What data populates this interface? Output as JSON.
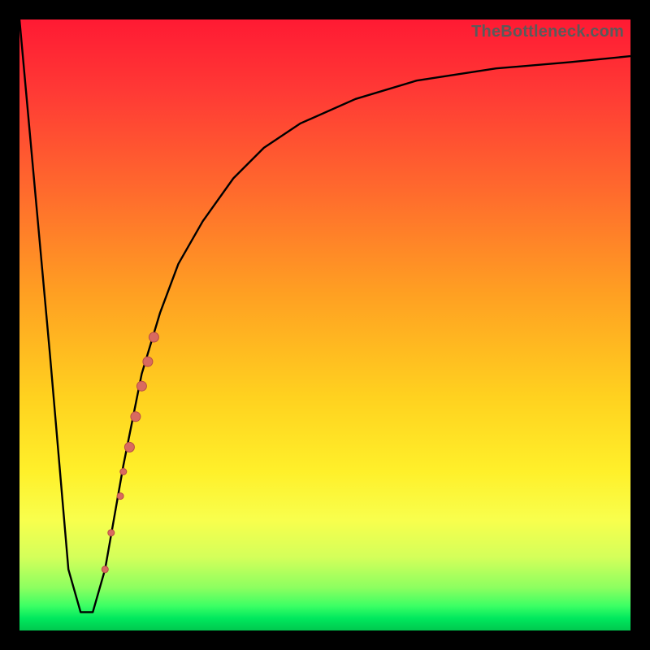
{
  "attribution": "TheBottleneck.com",
  "colors": {
    "background_frame": "#000000",
    "curve": "#000000",
    "marker_fill": "#d96a5f",
    "marker_stroke": "#b84d44"
  },
  "chart_data": {
    "type": "line",
    "title": "",
    "xlabel": "",
    "ylabel": "",
    "xlim": [
      0,
      100
    ],
    "ylim": [
      0,
      100
    ],
    "grid": false,
    "series": [
      {
        "name": "bottleneck-curve",
        "x": [
          0,
          5,
          8,
          10,
          12,
          14,
          17,
          20,
          23,
          26,
          30,
          35,
          40,
          46,
          55,
          65,
          78,
          90,
          100
        ],
        "values": [
          100,
          45,
          10,
          3,
          3,
          10,
          27,
          42,
          52,
          60,
          67,
          74,
          79,
          83,
          87,
          90,
          92,
          93,
          94
        ]
      }
    ],
    "markers": [
      {
        "x": 14.0,
        "y": 10.0,
        "r": 4
      },
      {
        "x": 15.0,
        "y": 16.0,
        "r": 4
      },
      {
        "x": 16.5,
        "y": 22.0,
        "r": 4
      },
      {
        "x": 17.0,
        "y": 26.0,
        "r": 4
      },
      {
        "x": 18.0,
        "y": 30.0,
        "r": 6
      },
      {
        "x": 19.0,
        "y": 35.0,
        "r": 6
      },
      {
        "x": 20.0,
        "y": 40.0,
        "r": 6
      },
      {
        "x": 21.0,
        "y": 44.0,
        "r": 6
      },
      {
        "x": 22.0,
        "y": 48.0,
        "r": 6
      }
    ],
    "gradient_stops": [
      {
        "pos": 0,
        "color": "#ff1a33"
      },
      {
        "pos": 12,
        "color": "#ff3a35"
      },
      {
        "pos": 28,
        "color": "#ff6a2d"
      },
      {
        "pos": 45,
        "color": "#ffa022"
      },
      {
        "pos": 62,
        "color": "#ffd21f"
      },
      {
        "pos": 74,
        "color": "#fff02a"
      },
      {
        "pos": 82,
        "color": "#f8ff4d"
      },
      {
        "pos": 88,
        "color": "#d4ff5a"
      },
      {
        "pos": 93,
        "color": "#8cff60"
      },
      {
        "pos": 96,
        "color": "#3bff64"
      },
      {
        "pos": 98,
        "color": "#00e85e"
      },
      {
        "pos": 100,
        "color": "#00c94f"
      }
    ]
  }
}
